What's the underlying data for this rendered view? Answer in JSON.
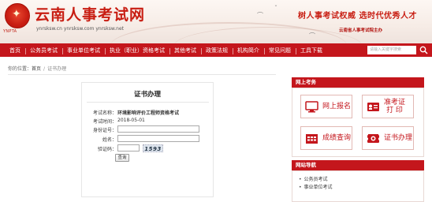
{
  "header": {
    "site_name": "云南人事考试网",
    "logo_sub": "YNPTA",
    "domains": "ynrsksw.cn ynrsksw.com ynrsksw.net",
    "slogan": "树人事考试权威  选时代优秀人才",
    "slogan_sub": "云南省人事考试院主办"
  },
  "nav": {
    "items": [
      "首页",
      "公务员考试",
      "事业单位考试",
      "执业（职业）资格考试",
      "其他考试",
      "政策法规",
      "机构简介",
      "常见问题",
      "工具下载"
    ],
    "search_placeholder": "请输入关键字搜索",
    "search_icon": "magnifier-icon"
  },
  "breadcrumb": {
    "prefix": "你的位置：",
    "home": "首页",
    "sep": "/",
    "current": "证书办理"
  },
  "panel": {
    "title": "证书办理",
    "exam_name_label": "考试名称：",
    "exam_name": "环境影响评价工程师资格考试",
    "exam_time_label": "考试时间：",
    "exam_time": "2018-05-01",
    "id_label": "身份证号：",
    "name_label": "姓名：",
    "captcha_label": "验证码：",
    "captcha_value": "1593",
    "query_button": "查询"
  },
  "sidebar": {
    "online_exam_title": "网上考务",
    "tiles": [
      {
        "label": "网上报名",
        "icon": "monitor-icon"
      },
      {
        "label_line1": "准考证",
        "label_line2": "打  印",
        "icon": "id-card-icon"
      },
      {
        "label": "成绩查询",
        "icon": "calendar-icon"
      },
      {
        "label": "证书办理",
        "icon": "certificate-icon"
      }
    ],
    "nav_title": "网站导航",
    "nav_links": [
      "公务员考试",
      "事业单位考试"
    ]
  },
  "colors": {
    "brand_red": "#c4161c",
    "header_bg": "#f6ece6"
  }
}
